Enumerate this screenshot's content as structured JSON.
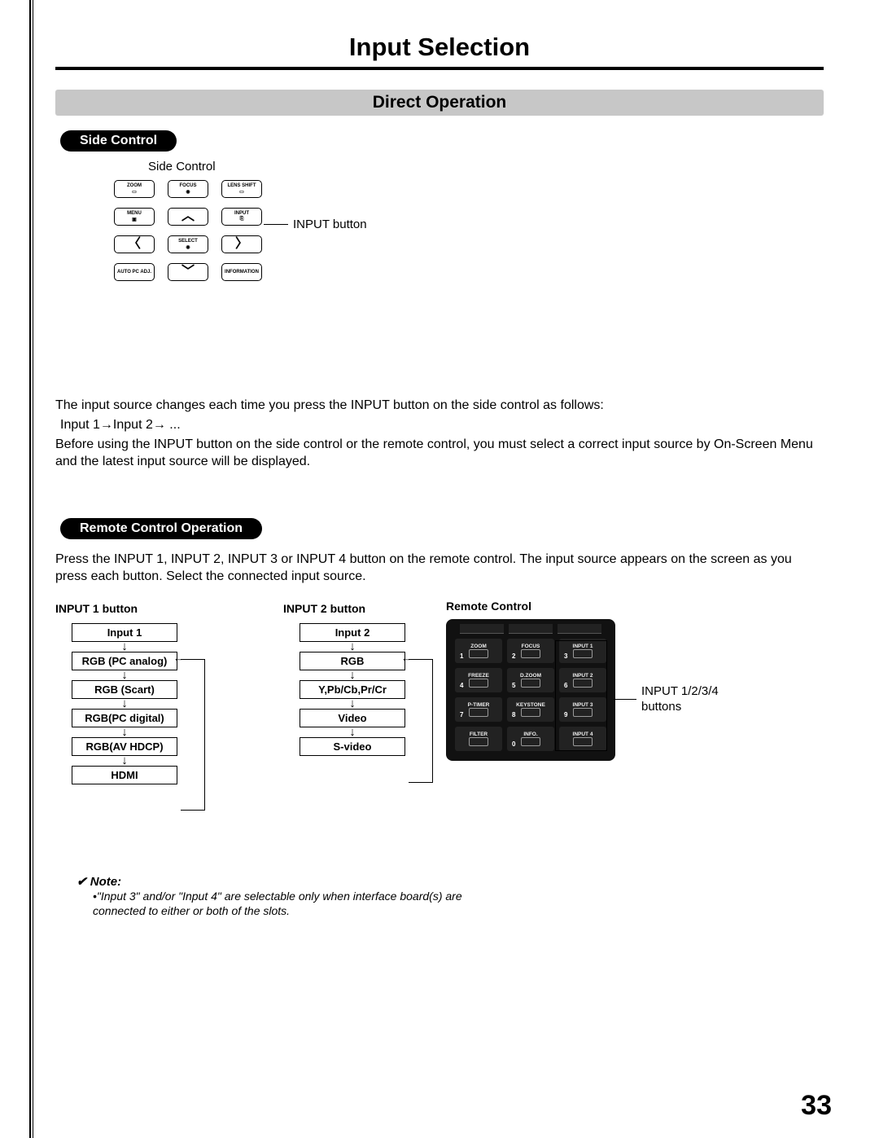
{
  "page": {
    "title": "Input Selection",
    "number": "33"
  },
  "section": {
    "bar": "Direct Operation"
  },
  "side": {
    "pill": "Side Control",
    "caption": "Side Control",
    "btns": {
      "zoom": "ZOOM",
      "focus": "FOCUS",
      "lensshift": "LENS SHIFT",
      "menu": "MENU",
      "input": "INPUT",
      "select": "SELECT",
      "autopc": "AUTO PC ADJ.",
      "info": "INFORMATION"
    },
    "leader": "INPUT button"
  },
  "para": {
    "p1": "The input source changes each time you press the INPUT button on the side control as follows:",
    "seq": "Input 1→Input 2→ ...",
    "p2": "Before using the INPUT button on the side control or the remote control, you must select a correct input source by On-Screen Menu and the latest input source will be displayed."
  },
  "rco": {
    "pill": "Remote Control Operation",
    "p": "Press the INPUT 1, INPUT 2, INPUT 3 or INPUT 4 button on the remote control. The input source appears on the screen as you press each button. Select the connected input source."
  },
  "flows": {
    "col1": {
      "head": "INPUT 1 button",
      "boxes": [
        "Input 1",
        "RGB (PC analog)",
        "RGB (Scart)",
        "RGB(PC digital)",
        "RGB(AV HDCP)",
        "HDMI"
      ]
    },
    "col2": {
      "head": "INPUT 2 button",
      "boxes": [
        "Input 2",
        "RGB",
        "Y,Pb/Cb,Pr/Cr",
        "Video",
        "S-video"
      ]
    }
  },
  "remote": {
    "title": "Remote Control",
    "leader": "INPUT 1/2/3/4 buttons",
    "cells": [
      {
        "t": "ZOOM",
        "n": "1"
      },
      {
        "t": "FOCUS",
        "n": "2"
      },
      {
        "t": "INPUT 1",
        "n": "3"
      },
      {
        "t": "FREEZE",
        "n": "4"
      },
      {
        "t": "D.ZOOM",
        "n": "5"
      },
      {
        "t": "INPUT 2",
        "n": "6"
      },
      {
        "t": "P-TIMER",
        "n": "7"
      },
      {
        "t": "KEYSTONE",
        "n": "8"
      },
      {
        "t": "INPUT 3",
        "n": "9"
      },
      {
        "t": "FILTER",
        "n": ""
      },
      {
        "t": "INFO.",
        "n": "0"
      },
      {
        "t": "INPUT 4",
        "n": ""
      }
    ]
  },
  "note": {
    "head": "Note:",
    "bullet": "•\"Input 3\" and/or \"Input 4\" are selectable only when interface board(s) are connected to either or both of the slots."
  }
}
